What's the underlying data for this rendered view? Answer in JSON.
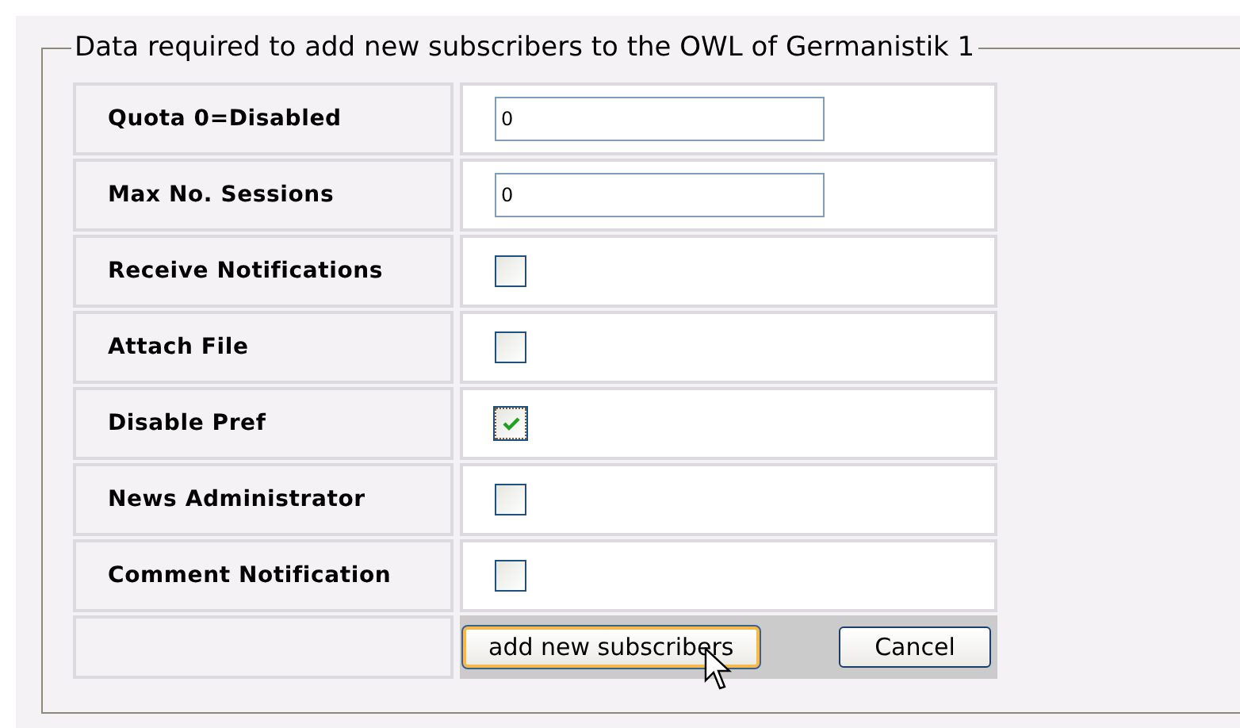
{
  "legend": "Data required to add new subscribers to the OWL of Germanistik 1",
  "rows": [
    {
      "label": "Quota 0=Disabled",
      "kind": "input",
      "value": "0"
    },
    {
      "label": "Max No. Sessions",
      "kind": "input",
      "value": "0"
    },
    {
      "label": "Receive Notifications",
      "kind": "checkbox",
      "checked": false
    },
    {
      "label": "Attach File",
      "kind": "checkbox",
      "checked": false
    },
    {
      "label": "Disable Pref",
      "kind": "checkbox",
      "checked": true
    },
    {
      "label": "News Administrator",
      "kind": "checkbox",
      "checked": false
    },
    {
      "label": "Comment Notification",
      "kind": "checkbox",
      "checked": false
    }
  ],
  "buttons": [
    {
      "label": "add new subscribers",
      "focused": true
    },
    {
      "label": "Cancel",
      "focused": false
    }
  ]
}
